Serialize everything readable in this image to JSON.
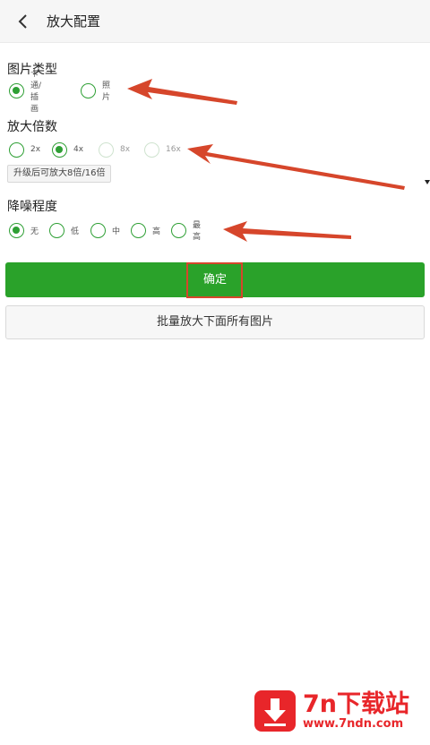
{
  "header": {
    "title": "放大配置",
    "back_icon": "back-arrow-icon"
  },
  "image_type": {
    "title": "图片类型",
    "options": [
      {
        "label": "卡通/插画",
        "checked": true
      },
      {
        "label": "照片",
        "checked": false
      }
    ]
  },
  "scale": {
    "title": "放大倍数",
    "options": [
      {
        "label": "2x",
        "checked": false,
        "disabled": false
      },
      {
        "label": "4x",
        "checked": true,
        "disabled": false
      },
      {
        "label": "8x",
        "checked": false,
        "disabled": true
      },
      {
        "label": "16x",
        "checked": false,
        "disabled": true
      }
    ],
    "upgrade_label": "升级后可放大8倍/16倍"
  },
  "denoise": {
    "title": "降噪程度",
    "options": [
      {
        "label": "无",
        "checked": true
      },
      {
        "label": "低",
        "checked": false
      },
      {
        "label": "中",
        "checked": false
      },
      {
        "label": "高",
        "checked": false
      },
      {
        "label": "最高",
        "checked": false
      }
    ]
  },
  "buttons": {
    "confirm_label": "确定",
    "batch_label": "批量放大下面所有图片"
  },
  "watermark": {
    "title": "7n下载站",
    "url": "www.7ndn.com",
    "icon": "download-arrow-icon"
  },
  "colors": {
    "accent": "#2aa22a",
    "annotation": "#d6462b",
    "watermark": "#e8262a"
  }
}
